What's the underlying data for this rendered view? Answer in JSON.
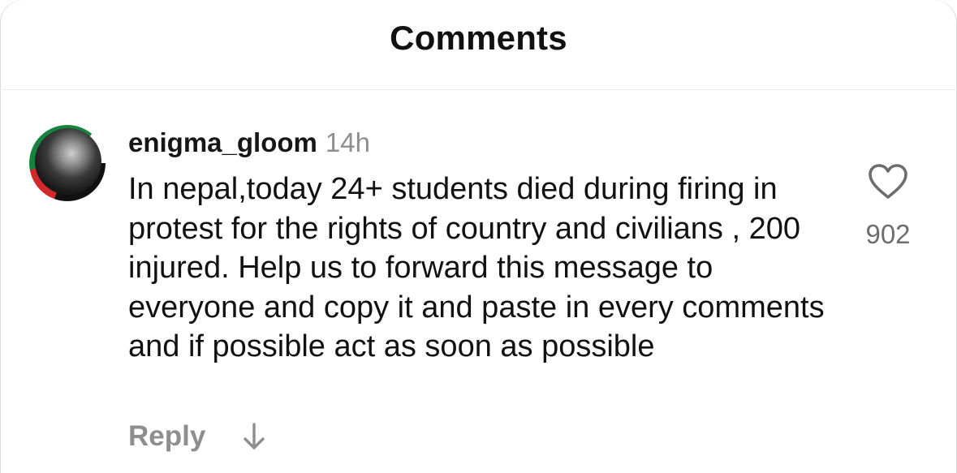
{
  "header": {
    "title": "Comments"
  },
  "comment": {
    "avatar_icon": "profile-avatar",
    "username": "enigma_gloom",
    "time": "14h",
    "text": "In nepal,today 24+ students died during firing in protest for the rights of country and civilians , 200 injured. Help us to forward this message to everyone and copy it and paste in every comments and if possible act as soon as possible",
    "like_icon": "heart-icon",
    "like_count": "902",
    "reply_label": "Reply",
    "replies_icon": "arrow-down-icon"
  },
  "colors": {
    "muted": "#8e8e8e",
    "text": "#111111",
    "divider": "#ececec"
  }
}
